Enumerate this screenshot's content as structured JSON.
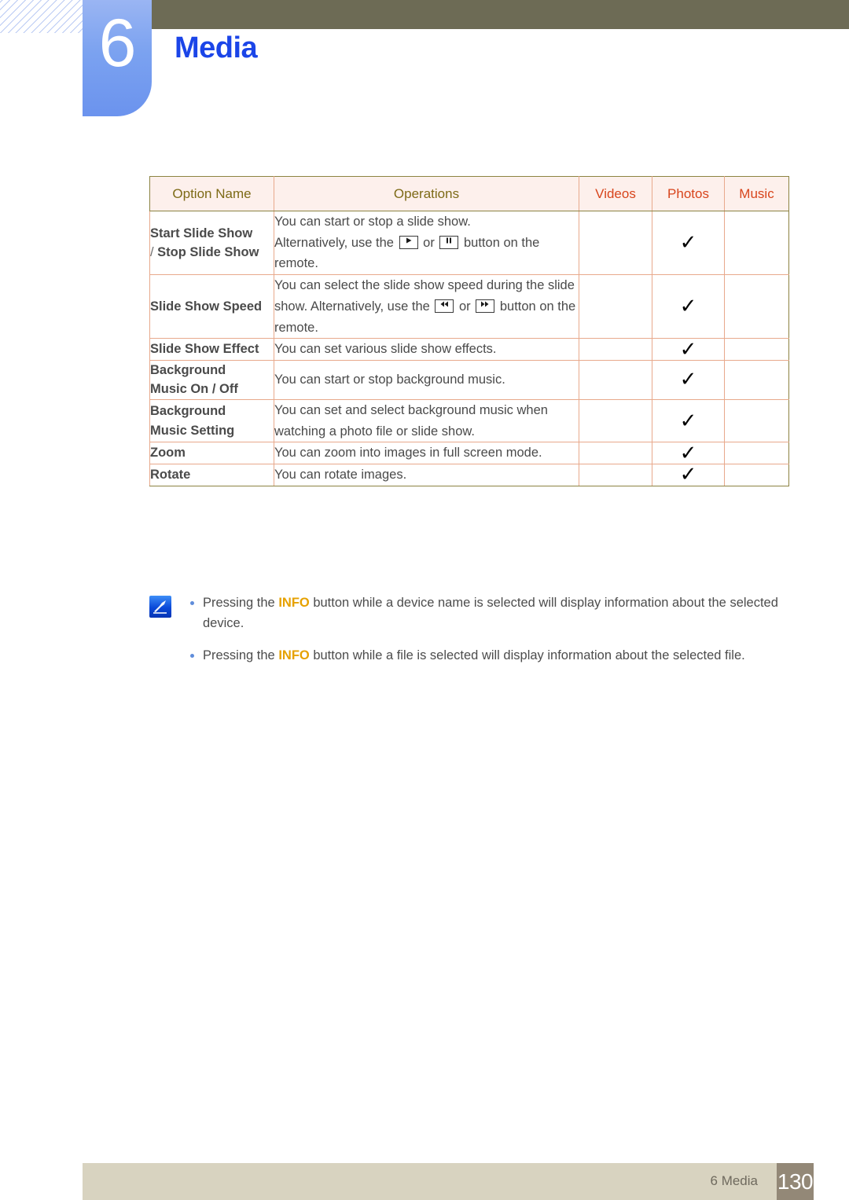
{
  "chapter": {
    "number": "6",
    "title": "Media"
  },
  "table": {
    "columns": [
      "Option Name",
      "Operations",
      "Videos",
      "Photos",
      "Music"
    ],
    "rows": [
      {
        "option_prefix": "Start Slide Show",
        "option_slash": " / ",
        "option_suffix": "Stop Slide Show",
        "operations_lines": [
          "You can start or stop a slide show.",
          "Alternatively, use the ▶ or ❙❙ button on the remote."
        ],
        "videos": "",
        "photos": "✓",
        "music": ""
      },
      {
        "option": "Slide Show Speed",
        "operations_lines": [
          "You can select the slide show speed during the slide show. Alternatively, use the ◀◀ or ▶▶ button on the remote."
        ],
        "videos": "",
        "photos": "✓",
        "music": ""
      },
      {
        "option": "Slide Show Effect",
        "operations_lines": [
          "You can set various slide show effects."
        ],
        "videos": "",
        "photos": "✓",
        "music": ""
      },
      {
        "option": "Background Music On / Off",
        "operations_lines": [
          "You can start or stop background music."
        ],
        "videos": "",
        "photos": "✓",
        "music": ""
      },
      {
        "option": "Background Music Setting",
        "operations_lines": [
          "You can set and select background music when watching a photo file or slide show."
        ],
        "videos": "",
        "photos": "✓",
        "music": ""
      },
      {
        "option": "Zoom",
        "operations_lines": [
          "You can zoom into images in full screen mode."
        ],
        "videos": "",
        "photos": "✓",
        "music": ""
      },
      {
        "option": "Rotate",
        "operations_lines": [
          "You can rotate images."
        ],
        "videos": "",
        "photos": "✓",
        "music": ""
      }
    ],
    "cells": {
      "r1_opt_a": "Start Slide Show",
      "r1_opt_slash": "/ ",
      "r1_opt_b": "Stop Slide Show",
      "r1_ops_l1": "You can start or stop a slide show.",
      "r1_ops_l2a": "Alternatively, use the",
      "r1_ops_l2b": "or",
      "r1_ops_l2c": "button on the",
      "r1_ops_l3": "remote.",
      "r2_opt": "Slide Show Speed",
      "r2_ops_a": "You can select the slide show speed during the slide show. Alternatively, use the",
      "r2_ops_b": "or",
      "r2_ops_c": "button on the remote.",
      "r3_opt": "Slide Show Effect",
      "r3_ops": "You can set various slide show effects.",
      "r4_opt_a": "Background",
      "r4_opt_b": "Music On / Off",
      "r4_ops": "You can start or stop background music.",
      "r5_opt_a": "Background",
      "r5_opt_b": "Music Setting",
      "r5_ops": "You can set and select background music when watching a photo file or slide show.",
      "r6_opt": "Zoom",
      "r6_ops": "You can zoom into images in full screen mode.",
      "r7_opt": "Rotate",
      "r7_ops": "You can rotate images."
    },
    "check_mark": "✓"
  },
  "notes": [
    {
      "before": "Pressing the ",
      "emphasis": "INFO",
      "after": " button while a device name is selected will display information about the selected device."
    },
    {
      "before": "Pressing the ",
      "emphasis": "INFO",
      "after": " button while a file is selected will display information about the selected file."
    }
  ],
  "footer": {
    "label": "6 Media",
    "page": "130"
  },
  "colors": {
    "header_bar": "#6d6b55",
    "chapter_tab": "#7ba2f0",
    "chapter_title": "#1b45e8",
    "option_text": "#d8451c",
    "column_header_olive": "#7d6a16",
    "column_header_orange": "#d8451c",
    "table_header_bg": "#fdf0ec",
    "table_border_inner": "#e8a98c",
    "table_border_outer": "#8c8342",
    "note_emphasis": "#e6a100",
    "footer_bar": "#d8d3c0",
    "page_badge": "#938877"
  }
}
